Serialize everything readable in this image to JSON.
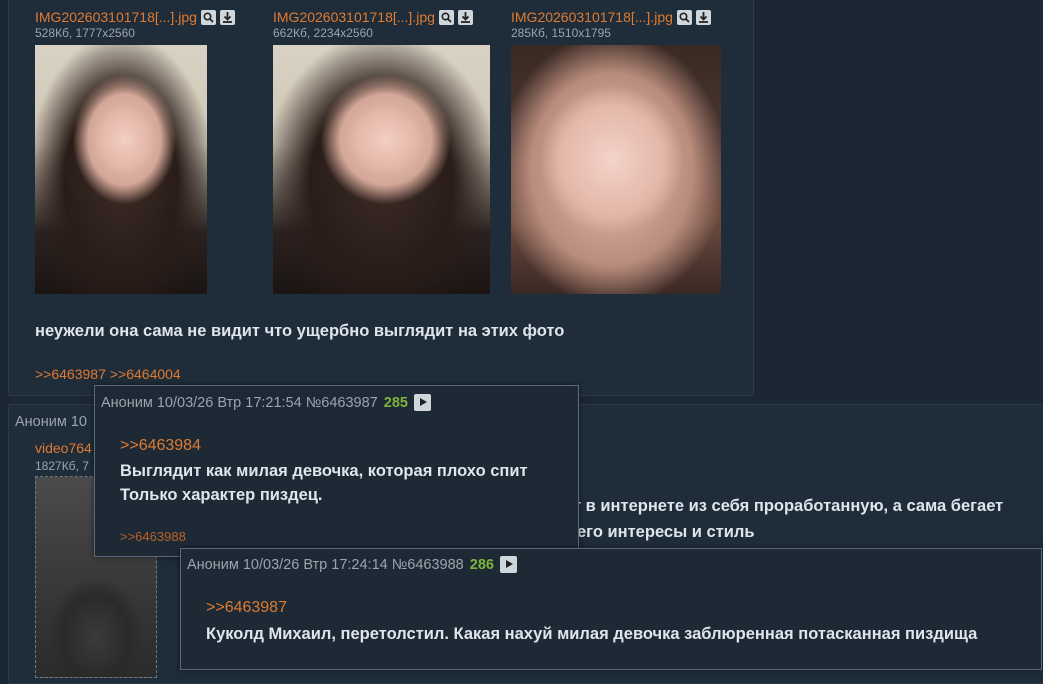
{
  "post1": {
    "files": [
      {
        "name": "IMG202603101718[...].jpg",
        "meta": "528Кб, 1777x2560"
      },
      {
        "name": "IMG202603101718[...].jpg",
        "meta": "662Кб, 2234x2560"
      },
      {
        "name": "IMG202603101718[...].jpg",
        "meta": "285Кб, 1510x1795"
      }
    ],
    "text": "неужели она сама не видит что ущербно выглядит на этих фото",
    "replies": [
      ">>6463987",
      ">>6464004"
    ]
  },
  "post2": {
    "author_partial": "Аноним 10",
    "file_name_partial": "video764",
    "file_meta_partial": "1827Кб, 7",
    "text_line1": "т в интернете из себя проработанную, а сама бегает",
    "text_line2": "его интересы и стиль"
  },
  "popup1": {
    "author": "Аноним",
    "datetime": "10/03/26 Втр 17:21:54",
    "postnum": "№6463987",
    "count": "285",
    "quote": ">>6463984",
    "line1": "Выглядит как милая девочка, которая плохо спит",
    "line2": "Только характер пиздец.",
    "reply": ">>6463988"
  },
  "popup2": {
    "author": "Аноним",
    "datetime": "10/03/26 Втр 17:24:14",
    "postnum": "№6463988",
    "count": "286",
    "quote": ">>6463987",
    "line1": "Куколд Михаил, перетолстил. Какая нахуй милая девочка заблюренная потасканная пиздища"
  },
  "colors": {
    "accent": "#e07a2f",
    "count": "#7fb43a",
    "bg": "#1b2733"
  }
}
